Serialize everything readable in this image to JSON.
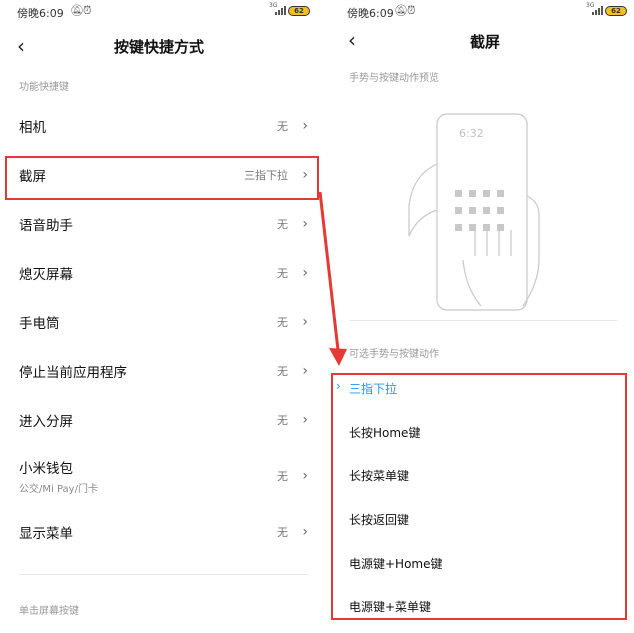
{
  "left": {
    "status": {
      "time": "傍晚6:09",
      "net": "3G",
      "battery": "62"
    },
    "header": {
      "title": "按键快捷方式"
    },
    "section1": "功能快捷键",
    "rows": [
      {
        "label": "相机",
        "value": "无"
      },
      {
        "label": "截屏",
        "value": "三指下拉"
      },
      {
        "label": "语音助手",
        "value": "无"
      },
      {
        "label": "熄灭屏幕",
        "value": "无"
      },
      {
        "label": "手电筒",
        "value": "无"
      },
      {
        "label": "停止当前应用程序",
        "value": "无"
      },
      {
        "label": "进入分屏",
        "value": "无"
      },
      {
        "label": "小米钱包",
        "sub": "公交/Mi Pay/门卡",
        "value": "无"
      },
      {
        "label": "显示菜单",
        "value": "无"
      }
    ],
    "section2": "单击屏幕按键"
  },
  "right": {
    "status": {
      "time": "傍晚6:09",
      "net": "3G",
      "battery": "62"
    },
    "header": {
      "title": "截屏"
    },
    "preview_label": "手势与按键动作预览",
    "preview_time": "6:32",
    "options_label": "可选手势与按键动作",
    "options": [
      {
        "label": "三指下拉",
        "selected": true
      },
      {
        "label": "长按Home键"
      },
      {
        "label": "长按菜单键"
      },
      {
        "label": "长按返回键"
      },
      {
        "label": "电源键+Home键"
      },
      {
        "label": "电源键+菜单键"
      }
    ]
  },
  "colors": {
    "highlight": "#e53935",
    "accent": "#2196f3",
    "battery": "#f4c01e"
  },
  "icons": [
    "back-icon",
    "chevron-right-icon",
    "bell-off-icon",
    "alarm-icon",
    "signal-icon",
    "battery-icon",
    "check-icon",
    "hand-gesture-illustration"
  ]
}
